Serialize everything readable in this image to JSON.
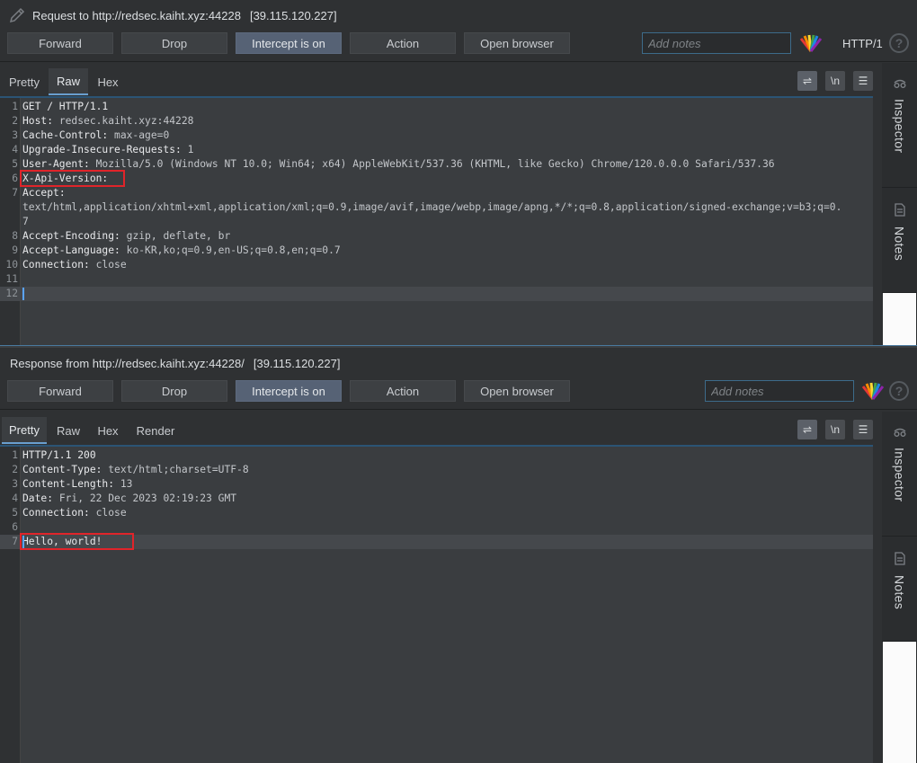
{
  "request": {
    "title": "Request to http://redsec.kaiht.xyz:44228",
    "ip": "[39.115.120.227]",
    "toolbar": {
      "forward": "Forward",
      "drop": "Drop",
      "intercept": "Intercept is on",
      "action": "Action",
      "open_browser": "Open browser",
      "notes_placeholder": "Add notes",
      "protocol": "HTTP/1"
    },
    "tabs": [
      "Pretty",
      "Raw",
      "Hex"
    ],
    "active_tab": "Raw",
    "lines": [
      {
        "n": "1",
        "name": "GET / HTTP/1.1",
        "sep": "",
        "value": ""
      },
      {
        "n": "2",
        "name": "Host",
        "sep": ": ",
        "value": "redsec.kaiht.xyz:44228"
      },
      {
        "n": "3",
        "name": "Cache-Control",
        "sep": ": ",
        "value": "max-age=0"
      },
      {
        "n": "4",
        "name": "Upgrade-Insecure-Requests",
        "sep": ": ",
        "value": "1"
      },
      {
        "n": "5",
        "name": "User-Agent",
        "sep": ": ",
        "value": "Mozilla/5.0 (Windows NT 10.0; Win64; x64) AppleWebKit/537.36 (KHTML, like Gecko) Chrome/120.0.0.0 Safari/537.36"
      },
      {
        "n": "6",
        "name": "X-Api-Version",
        "sep": ": ",
        "value": ""
      },
      {
        "n": "7",
        "name": "Accept",
        "sep": ":",
        "value": ""
      },
      {
        "n": "",
        "name": "",
        "sep": "",
        "value": "text/html,application/xhtml+xml,application/xml;q=0.9,image/avif,image/webp,image/apng,*/*;q=0.8,application/signed-exchange;v=b3;q=0."
      },
      {
        "n": "",
        "name": "",
        "sep": "",
        "value": "7"
      },
      {
        "n": "8",
        "name": "Accept-Encoding",
        "sep": ": ",
        "value": "gzip, deflate, br"
      },
      {
        "n": "9",
        "name": "Accept-Language",
        "sep": ": ",
        "value": "ko-KR,ko;q=0.9,en-US;q=0.8,en;q=0.7"
      },
      {
        "n": "10",
        "name": "Connection",
        "sep": ": ",
        "value": "close"
      },
      {
        "n": "11",
        "name": "",
        "sep": "",
        "value": ""
      },
      {
        "n": "12",
        "name": "",
        "sep": "",
        "value": ""
      }
    ],
    "side": {
      "inspector": "Inspector",
      "notes": "Notes"
    }
  },
  "response": {
    "title": "Response from http://redsec.kaiht.xyz:44228/",
    "ip": "[39.115.120.227]",
    "toolbar": {
      "forward": "Forward",
      "drop": "Drop",
      "intercept": "Intercept is on",
      "action": "Action",
      "open_browser": "Open browser",
      "notes_placeholder": "Add notes"
    },
    "tabs": [
      "Pretty",
      "Raw",
      "Hex",
      "Render"
    ],
    "active_tab": "Pretty",
    "lines": [
      {
        "n": "1",
        "name": "HTTP/1.1 200",
        "sep": "",
        "value": ""
      },
      {
        "n": "2",
        "name": "Content-Type",
        "sep": ": ",
        "value": "text/html;charset=UTF-8"
      },
      {
        "n": "3",
        "name": "Content-Length",
        "sep": ": ",
        "value": "13"
      },
      {
        "n": "4",
        "name": "Date",
        "sep": ": ",
        "value": "Fri, 22 Dec 2023 02:19:23 GMT"
      },
      {
        "n": "5",
        "name": "Connection",
        "sep": ": ",
        "value": "close"
      },
      {
        "n": "6",
        "name": "",
        "sep": "",
        "value": ""
      },
      {
        "n": "7",
        "name": "Hello, world!",
        "sep": "",
        "value": ""
      }
    ],
    "side": {
      "inspector": "Inspector",
      "notes": "Notes"
    }
  },
  "tools": {
    "wrap": "⇌",
    "newline": "\\n",
    "menu": "☰"
  },
  "colors": {
    "highlight": "#e0242a",
    "accent": "#6a9fcf",
    "intercept_on": "#566275"
  }
}
